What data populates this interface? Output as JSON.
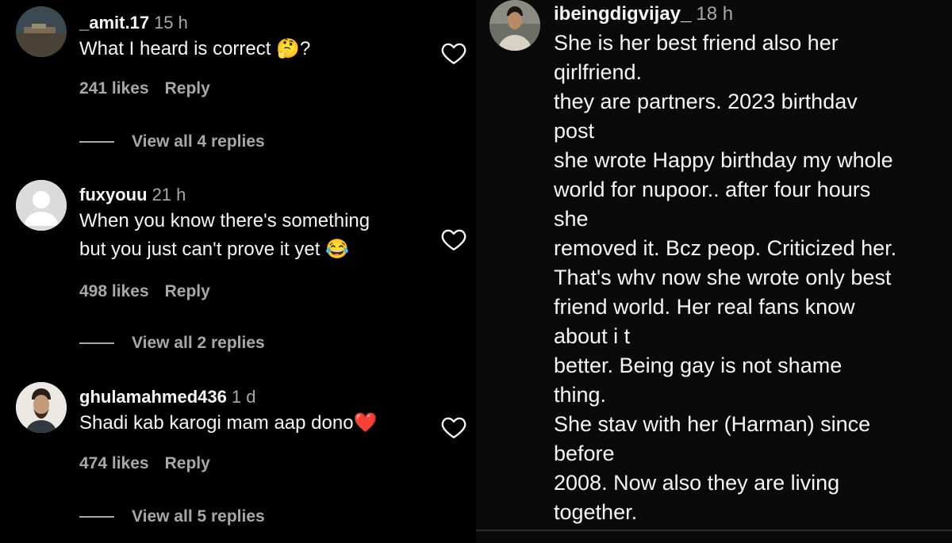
{
  "left_comments": [
    {
      "username": "_amit.17",
      "time": "15 h",
      "text": "What I heard is correct 🤔?",
      "likes": "241 likes",
      "reply_label": "Reply",
      "view_replies": "View all 4 replies",
      "avatar": "landscape-avatar"
    },
    {
      "username": "fuxyouu",
      "time": "21 h",
      "text_lines": [
        "When you know there's something",
        "but you just can't prove it yet 😂"
      ],
      "likes": "498 likes",
      "reply_label": "Reply",
      "view_replies": "View all 2 replies",
      "avatar": "default-user-avatar"
    },
    {
      "username": "ghulamahmed436",
      "time": "1 d",
      "text": "Shadi kab karogi mam aap dono❤️",
      "likes": "474 likes",
      "reply_label": "Reply",
      "view_replies": "View all 5 replies",
      "avatar": "person-photo-avatar"
    }
  ],
  "right_comment": {
    "username": "ibeingdigvijay_",
    "time": "18 h",
    "lines": [
      "She is her best friend also her",
      "qirlfriend.",
      "they are partners. 2023 birthdav",
      "post",
      "she wrote Happy birthday my whole",
      "world for nupoor.. after four hours",
      "she",
      "removed it. Bcz peop. Criticized her.",
      "That's whv now she wrote only best",
      "friend world. Her real fans know",
      "about i t",
      "better. Being gay is not shame",
      "thing.",
      "She stav with her (Harman) since",
      "before",
      "2008. Now also they are living",
      "together."
    ]
  },
  "icons": {
    "heart": "heart-outline-icon"
  },
  "colors": {
    "background": "#000000",
    "text": "#f5f5f5",
    "secondary": "#a8a8a8",
    "heart_emoji": "#e0245e"
  }
}
